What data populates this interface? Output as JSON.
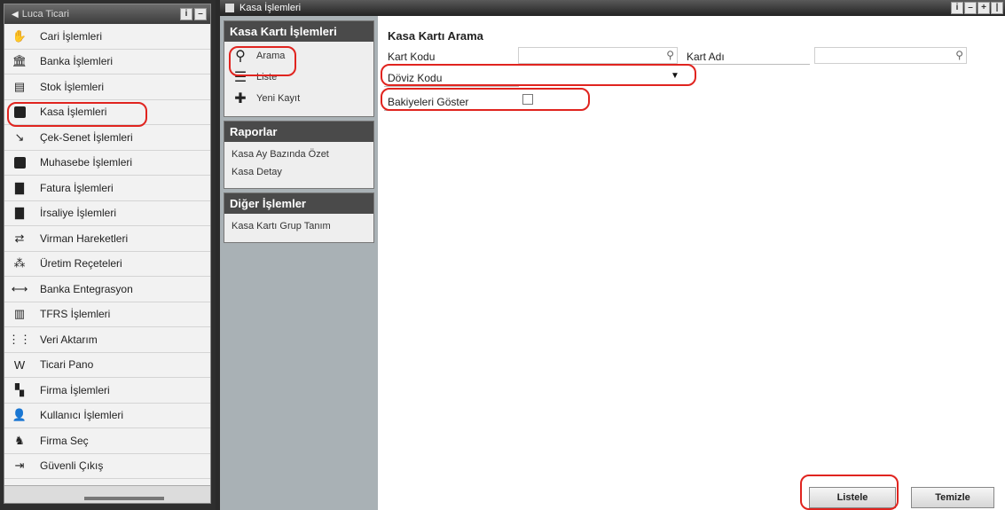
{
  "sidebar": {
    "header": "Luca Ticari",
    "items": [
      {
        "label": "Cari İşlemleri",
        "icon": "handshake-icon"
      },
      {
        "label": "Banka İşlemleri",
        "icon": "bank-icon"
      },
      {
        "label": "Stok İşlemleri",
        "icon": "stock-icon"
      },
      {
        "label": "Kasa İşlemleri",
        "icon": "cashbox-icon"
      },
      {
        "label": "Çek-Senet İşlemleri",
        "icon": "cheque-icon"
      },
      {
        "label": "Muhasebe İşlemleri",
        "icon": "calculator-icon"
      },
      {
        "label": "Fatura İşlemleri",
        "icon": "invoice-icon"
      },
      {
        "label": "İrsaliye İşlemleri",
        "icon": "waybill-icon"
      },
      {
        "label": "Virman Hareketleri",
        "icon": "transfer-icon"
      },
      {
        "label": "Üretim Reçeteleri",
        "icon": "production-icon"
      },
      {
        "label": "Banka Entegrasyon",
        "icon": "integration-icon"
      },
      {
        "label": "TFRS İşlemleri",
        "icon": "chart-icon"
      },
      {
        "label": "Veri Aktarım",
        "icon": "data-transfer-icon"
      },
      {
        "label": "Ticari Pano",
        "icon": "board-icon"
      },
      {
        "label": "Firma İşlemleri",
        "icon": "company-icon"
      },
      {
        "label": "Kullanıcı İşlemleri",
        "icon": "user-icon"
      },
      {
        "label": "Firma Seç",
        "icon": "select-company-icon"
      },
      {
        "label": "Güvenli Çıkış",
        "icon": "exit-icon"
      }
    ]
  },
  "window": {
    "title": "Kasa İşlemleri"
  },
  "panel": {
    "kart": {
      "title": "Kasa Kartı İşlemleri",
      "items": [
        {
          "label": "Arama",
          "icon": "search-icon"
        },
        {
          "label": "Liste",
          "icon": "list-icon"
        },
        {
          "label": "Yeni Kayıt",
          "icon": "new-record-icon"
        }
      ]
    },
    "raporlar": {
      "title": "Raporlar",
      "items": [
        "Kasa Ay Bazında Özet",
        "Kasa Detay"
      ]
    },
    "diger": {
      "title": "Diğer İşlemler",
      "items": [
        "Kasa Kartı Grup Tanım"
      ]
    }
  },
  "form": {
    "title": "Kasa Kartı Arama",
    "kart_kodu_label": "Kart Kodu",
    "kart_kodu_value": "",
    "kart_adi_label": "Kart Adı",
    "kart_adi_value": "",
    "doviz_label": "Döviz Kodu",
    "doviz_value": "",
    "bakiye_label": "Bakiyeleri Göster",
    "bakiye_checked": false
  },
  "buttons": {
    "listele": "Listele",
    "temizle": "Temizle"
  },
  "colors": {
    "highlight": "#e0241f",
    "panel_bg": "#a9b1b5",
    "header_dark": "#4a4a4a"
  }
}
